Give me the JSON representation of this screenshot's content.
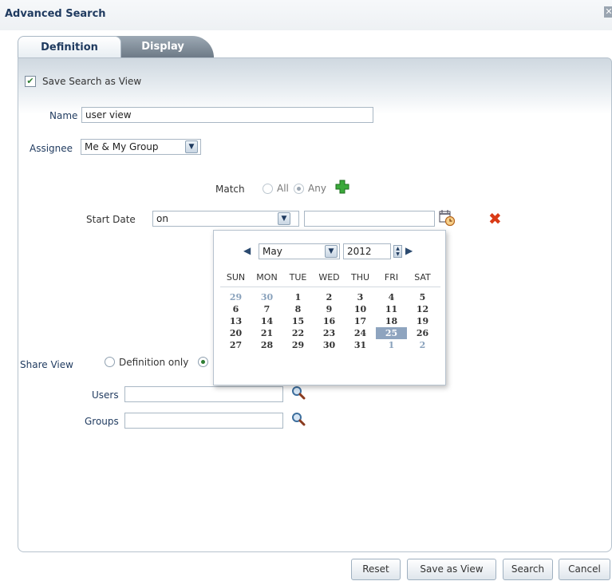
{
  "window": {
    "title": "Advanced Search"
  },
  "tabs": [
    {
      "label": "Definition",
      "selected": true
    },
    {
      "label": "Display",
      "selected": false
    }
  ],
  "save_view": {
    "label": "Save Search as View",
    "checked": true
  },
  "name": {
    "label": "Name",
    "value": "user view"
  },
  "assignee": {
    "label": "Assignee",
    "selected": "Me & My Group"
  },
  "match": {
    "label": "Match",
    "options": [
      "All",
      "Any"
    ],
    "selected": "Any"
  },
  "start_date": {
    "label": "Start Date",
    "operator": "on",
    "value": ""
  },
  "calendar": {
    "month": "May",
    "year": "2012",
    "weekdays": [
      "SUN",
      "MON",
      "TUE",
      "WED",
      "THU",
      "FRI",
      "SAT"
    ],
    "weeks": [
      [
        "29",
        "30",
        "1",
        "2",
        "3",
        "4",
        "5"
      ],
      [
        "6",
        "7",
        "8",
        "9",
        "10",
        "11",
        "12"
      ],
      [
        "13",
        "14",
        "15",
        "16",
        "17",
        "18",
        "19"
      ],
      [
        "20",
        "21",
        "22",
        "23",
        "24",
        "25",
        "26"
      ],
      [
        "27",
        "28",
        "29",
        "30",
        "31",
        "1",
        "2"
      ]
    ],
    "selected_day": "25"
  },
  "share_view": {
    "label": "Share View",
    "option_definition_only": "Definition only"
  },
  "users": {
    "label": "Users",
    "value": ""
  },
  "groups": {
    "label": "Groups",
    "value": ""
  },
  "buttons": {
    "reset": "Reset",
    "save_as_view": "Save as View",
    "search": "Search",
    "cancel": "Cancel"
  },
  "colors": {
    "accent": "#1f3a5f",
    "check_green": "#2e7d32",
    "delete_red": "#d93a16",
    "selected_day_bg": "#8ea4bf"
  }
}
